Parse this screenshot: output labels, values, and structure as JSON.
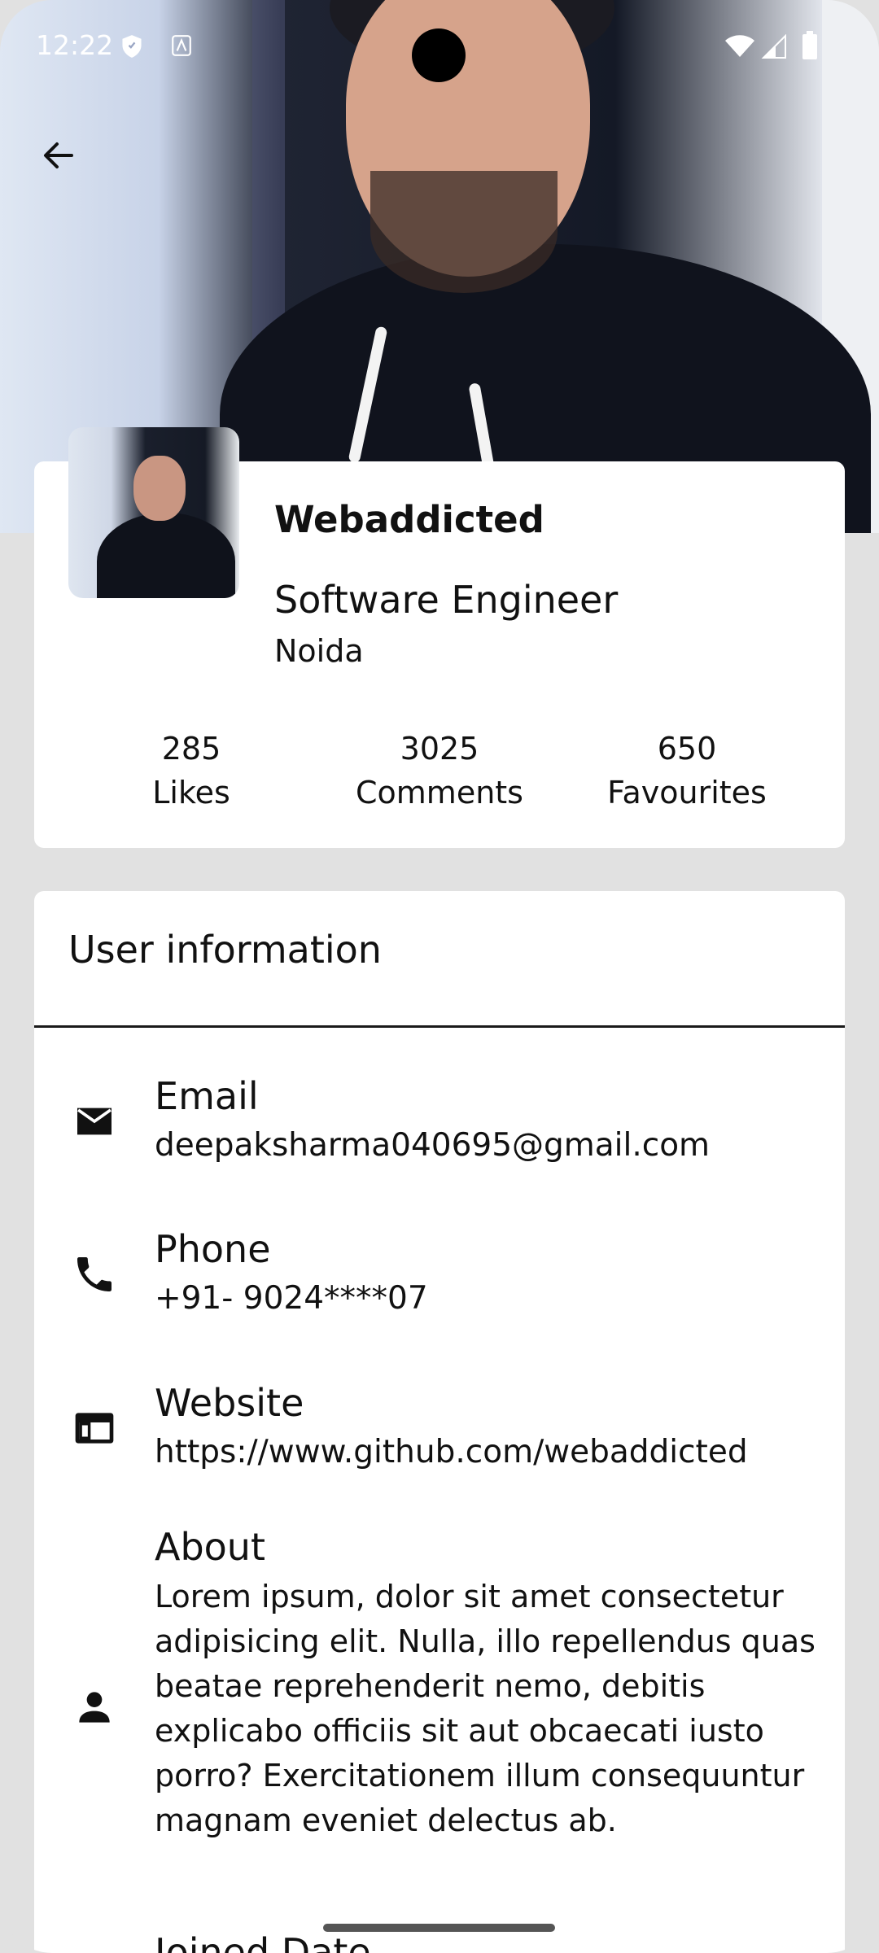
{
  "status_bar": {
    "time": "12:22",
    "icons": [
      "shield-icon",
      "app-icon",
      "wifi-icon",
      "signal-icon",
      "battery-icon"
    ]
  },
  "header": {
    "back_icon": "arrow-left-icon",
    "cover_photo": "profile-cover-photo"
  },
  "profile": {
    "name": "Webaddicted",
    "role": "Software Engineer",
    "location": "Noida",
    "stats": [
      {
        "value": "285",
        "label": "Likes"
      },
      {
        "value": "3025",
        "label": "Comments"
      },
      {
        "value": "650",
        "label": "Favourites"
      }
    ]
  },
  "user_info": {
    "title": "User information",
    "rows": [
      {
        "icon": "mail-icon",
        "label": "Email",
        "value": "deepaksharma040695@gmail.com"
      },
      {
        "icon": "phone-icon",
        "label": "Phone",
        "value": "+91- 9024****07"
      },
      {
        "icon": "web-icon",
        "label": "Website",
        "value": "https://www.github.com/webaddicted"
      },
      {
        "icon": "person-icon",
        "label": "About",
        "value": "Lorem ipsum, dolor sit amet consectetur adipisicing elit. Nulla, illo repellendus quas beatae reprehenderit nemo, debitis explicabo officiis sit aut obcaecati iusto porro? Exercitationem illum consequuntur magnam eveniet delectus ab."
      }
    ],
    "next_label": "Joined Date"
  },
  "colors": {
    "background": "#e1e1e1",
    "card": "#ffffff",
    "text": "#111111"
  }
}
